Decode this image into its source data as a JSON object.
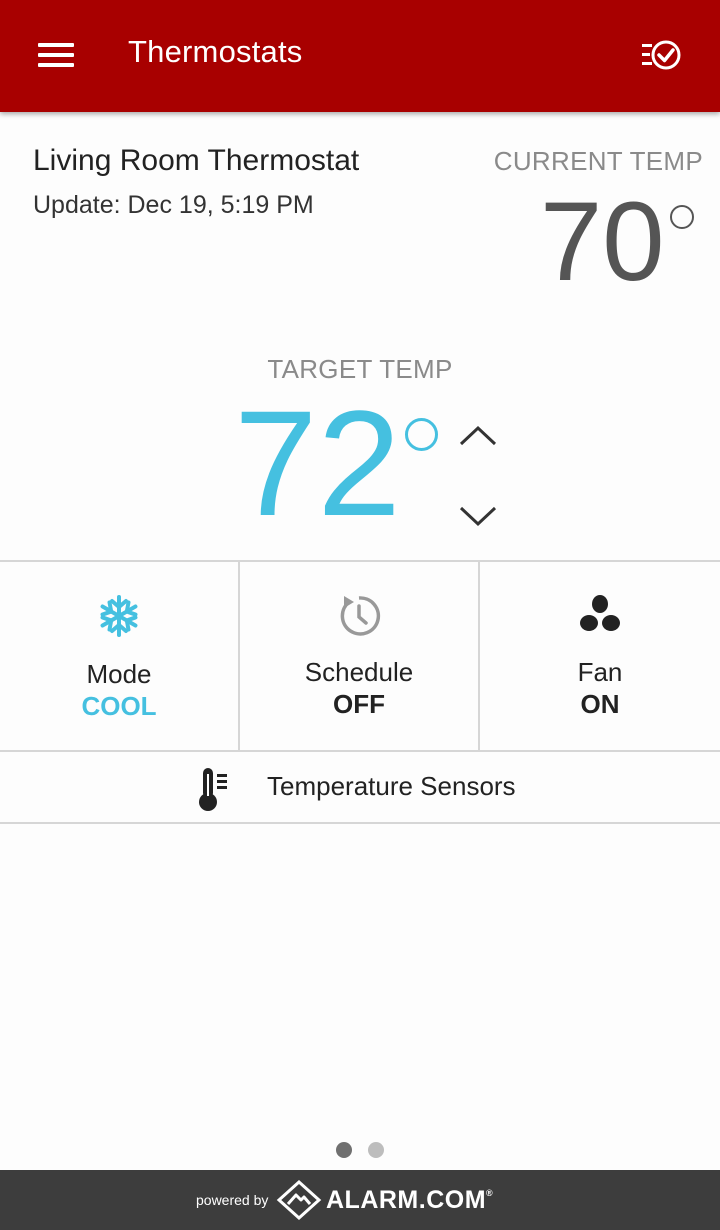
{
  "app_bar": {
    "title": "Thermostats",
    "menu_icon": "hamburger-menu-icon",
    "action_icon": "checklist-check-icon",
    "background_color": "#a80000"
  },
  "device": {
    "name": "Living Room Thermostat",
    "update_text": "Update: Dec 19, 5:19 PM"
  },
  "current": {
    "label": "CURRENT TEMP",
    "value": "70"
  },
  "target": {
    "label": "TARGET TEMP",
    "value": "72",
    "color": "#45c0e0",
    "increase_icon": "chevron-up-icon",
    "decrease_icon": "chevron-down-icon"
  },
  "tiles": [
    {
      "label": "Mode",
      "value": "COOL",
      "icon": "snowflake-icon",
      "value_color": "#45c0e0"
    },
    {
      "label": "Schedule",
      "value": "OFF",
      "icon": "schedule-clock-icon",
      "value_color": "#222222"
    },
    {
      "label": "Fan",
      "value": "ON",
      "icon": "fan-icon",
      "value_color": "#222222"
    }
  ],
  "sensors": {
    "label": "Temperature Sensors",
    "icon": "thermometer-icon"
  },
  "pager": {
    "total": 2,
    "active": 1
  },
  "footer": {
    "powered_by": "powered by",
    "brand": "ALARM.COM",
    "brand_mark": "®",
    "logo_icon": "alarm-com-logo-icon",
    "background_color": "#3d3d3d"
  }
}
